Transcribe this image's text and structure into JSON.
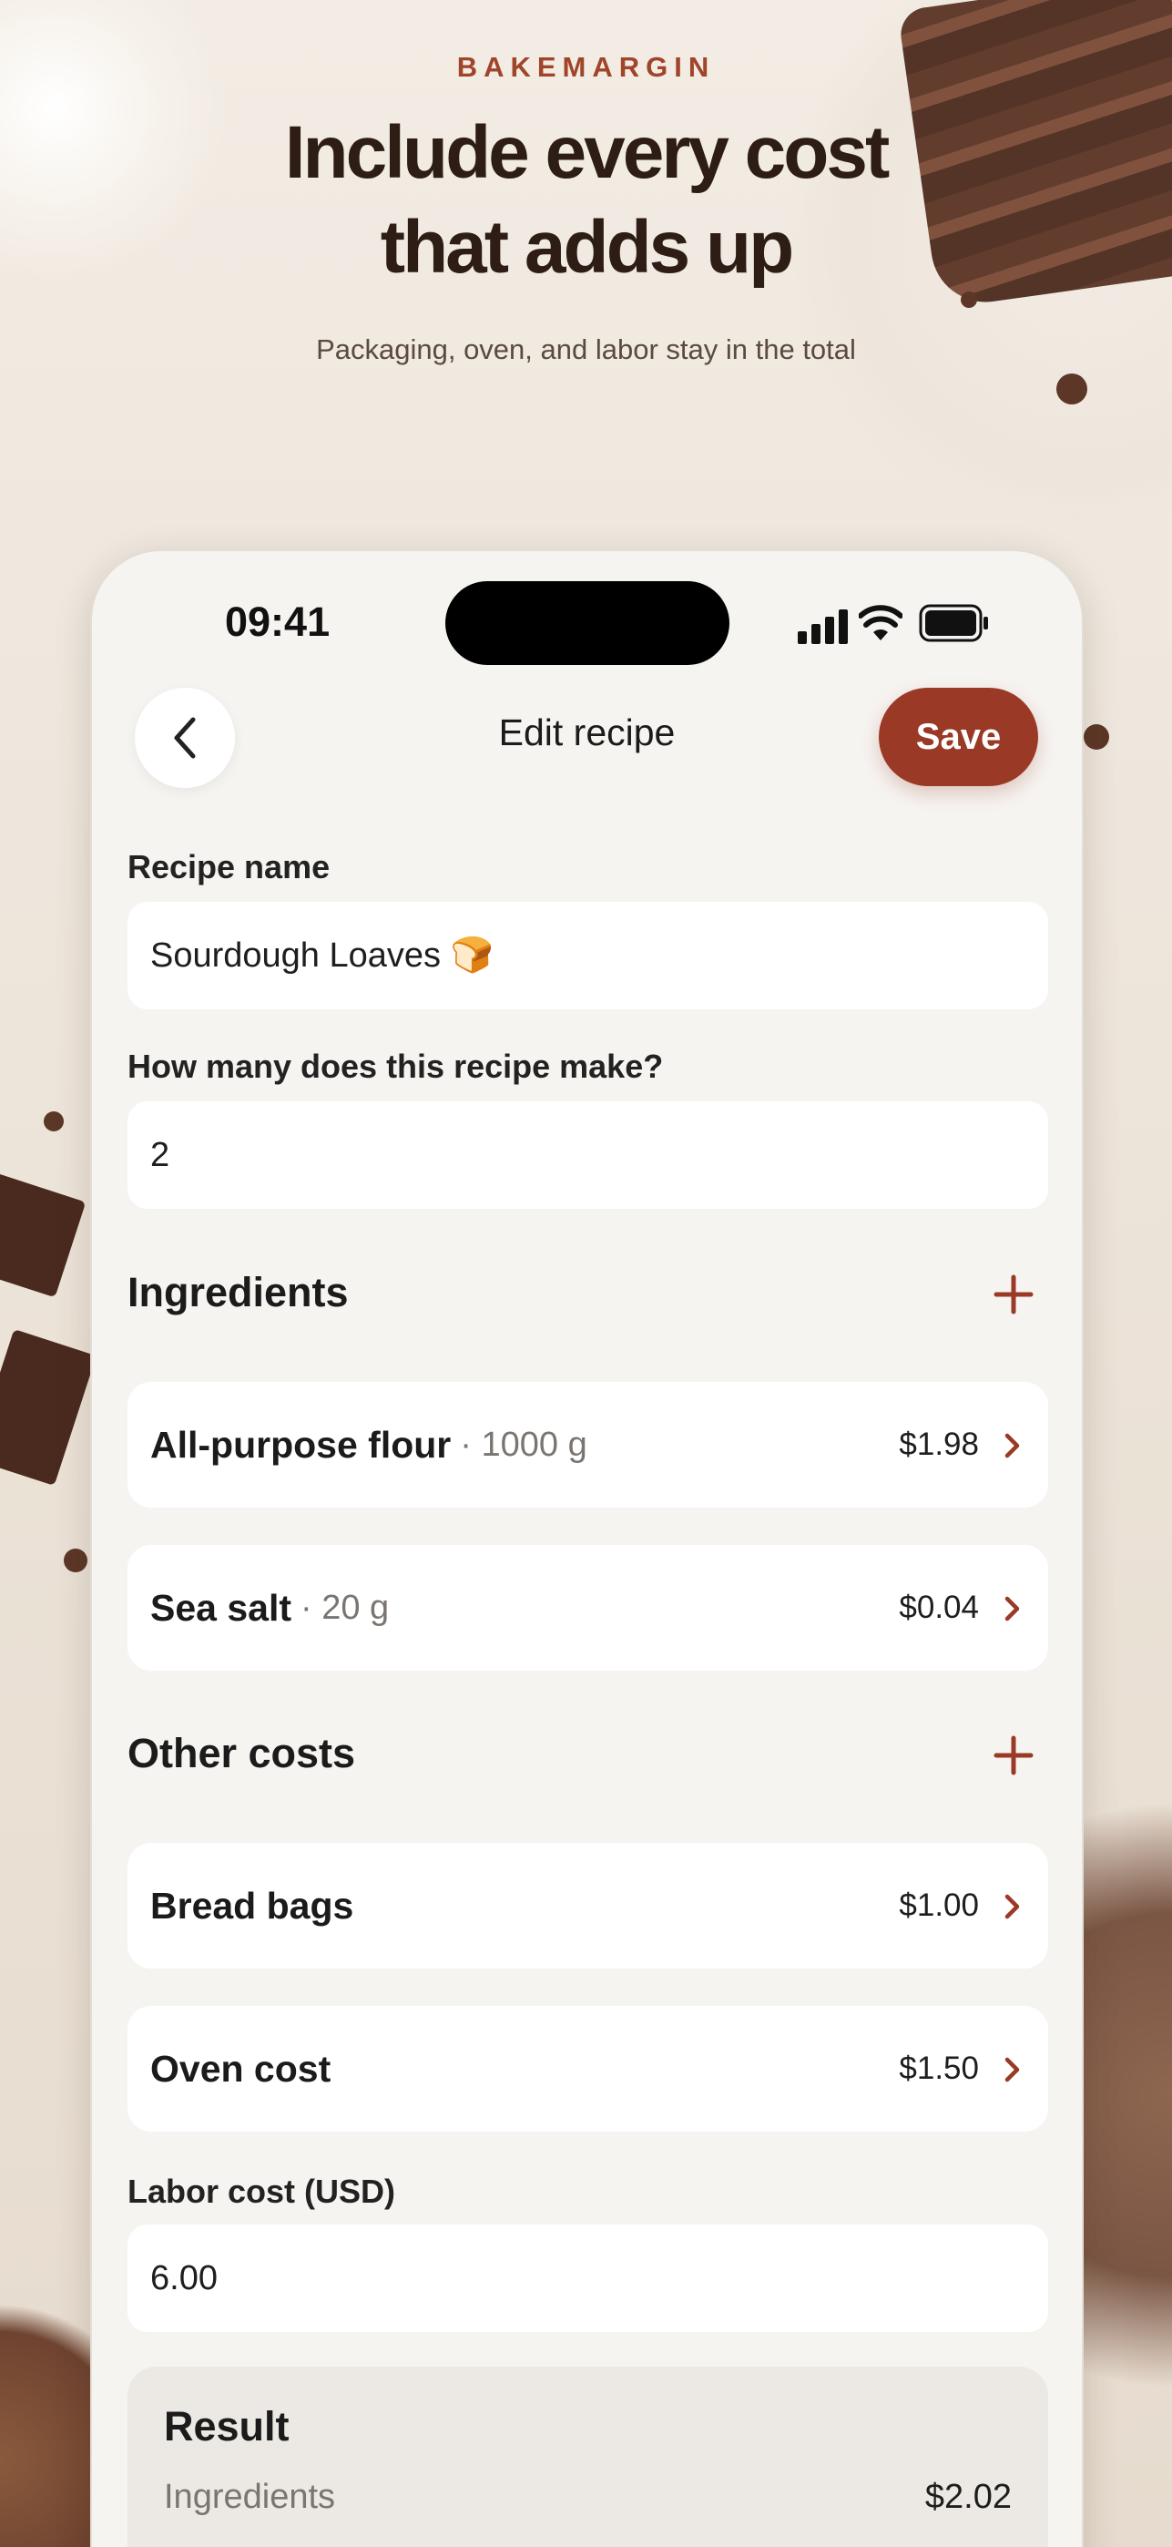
{
  "hero": {
    "brand": "BAKEMARGIN",
    "headline_line1": "Include every cost",
    "headline_line2": "that adds up",
    "subline": "Packaging, oven, and labor stay in the total"
  },
  "status_bar": {
    "time": "09:41"
  },
  "nav": {
    "title": "Edit recipe",
    "save_label": "Save"
  },
  "form": {
    "recipe_name_label": "Recipe name",
    "recipe_name_value": "Sourdough Loaves 🍞",
    "yield_label": "How many does this recipe make?",
    "yield_value": "2",
    "labor_label": "Labor cost (USD)",
    "labor_value": "6.00"
  },
  "ingredients": {
    "title": "Ingredients",
    "items": [
      {
        "name": "All-purpose flour",
        "qty": "· 1000 g",
        "price": "$1.98"
      },
      {
        "name": "Sea salt",
        "qty": "· 20 g",
        "price": "$0.04"
      }
    ]
  },
  "other_costs": {
    "title": "Other costs",
    "items": [
      {
        "name": "Bread bags",
        "price": "$1.00"
      },
      {
        "name": "Oven cost",
        "price": "$1.50"
      }
    ]
  },
  "result": {
    "title": "Result",
    "rows": [
      {
        "label": "Ingredients",
        "value": "$2.02"
      }
    ]
  },
  "colors": {
    "accent": "#9a3a26",
    "brand_text": "#a0452a",
    "background": "#f6f4f1"
  }
}
